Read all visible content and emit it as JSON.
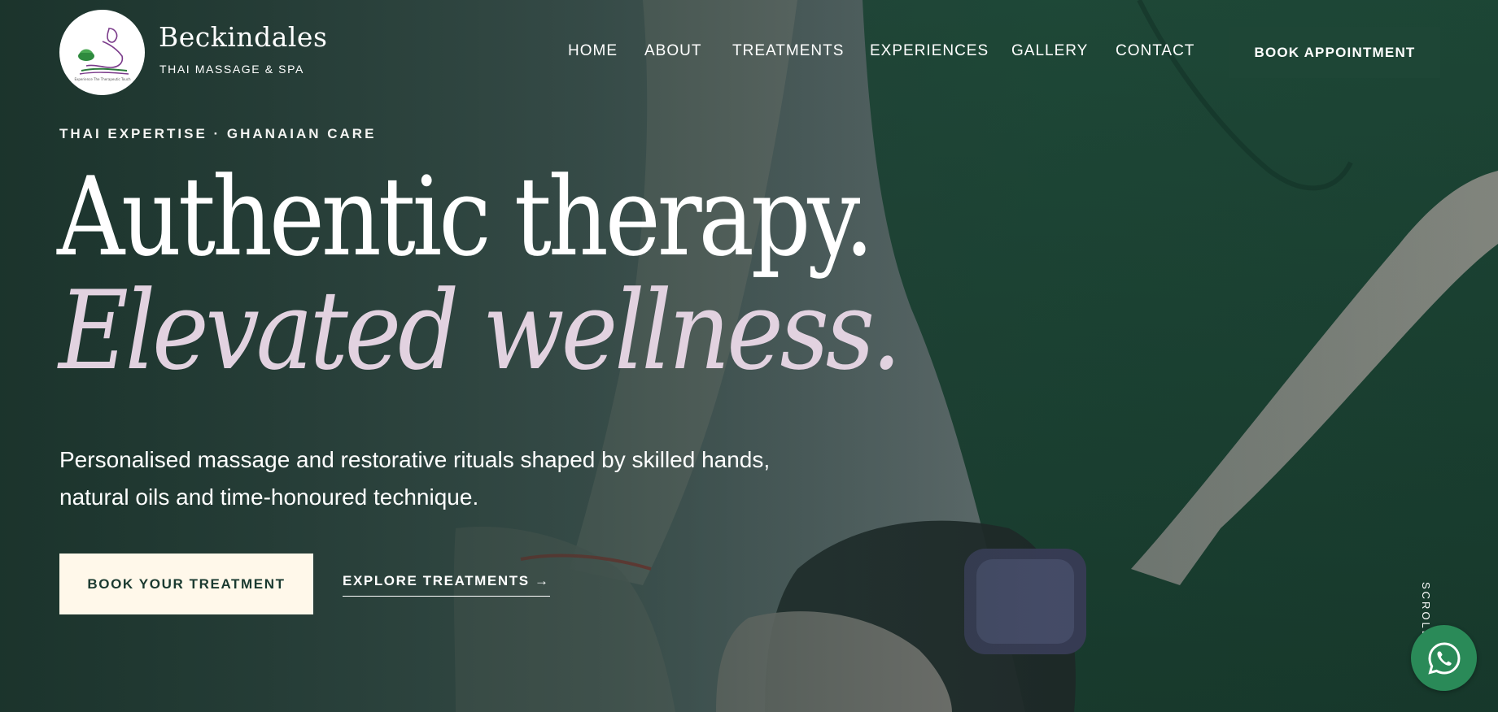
{
  "brand": {
    "name": "Beckindales",
    "tagline": "THAI MASSAGE & SPA",
    "logo_icon": "massage-logo-icon"
  },
  "nav": {
    "items": [
      {
        "label": "HOME"
      },
      {
        "label": "ABOUT"
      },
      {
        "label": "TREATMENTS"
      },
      {
        "label": "EXPERIENCES"
      },
      {
        "label": "GALLERY"
      },
      {
        "label": "CONTACT"
      }
    ],
    "book_label": "BOOK APPOINTMENT"
  },
  "hero": {
    "eyebrow": "THAI EXPERTISE · GHANAIAN CARE",
    "headline_line1": "Authentic therapy.",
    "headline_line2": "Elevated wellness.",
    "lead_line1": "Personalised massage and restorative rituals shaped by skilled hands,",
    "lead_line2": "natural oils and time-honoured technique.",
    "cta_primary": "BOOK YOUR TREATMENT",
    "cta_secondary": "EXPLORE TREATMENTS →",
    "scroll_label": "SCROLL"
  },
  "floating": {
    "whatsapp_icon": "whatsapp-icon"
  },
  "colors": {
    "accent_dark_green": "#1e4636",
    "cream": "#fff8ea",
    "headline_lilac": "#e2d2e0",
    "whatsapp_green": "#2a8a58"
  }
}
